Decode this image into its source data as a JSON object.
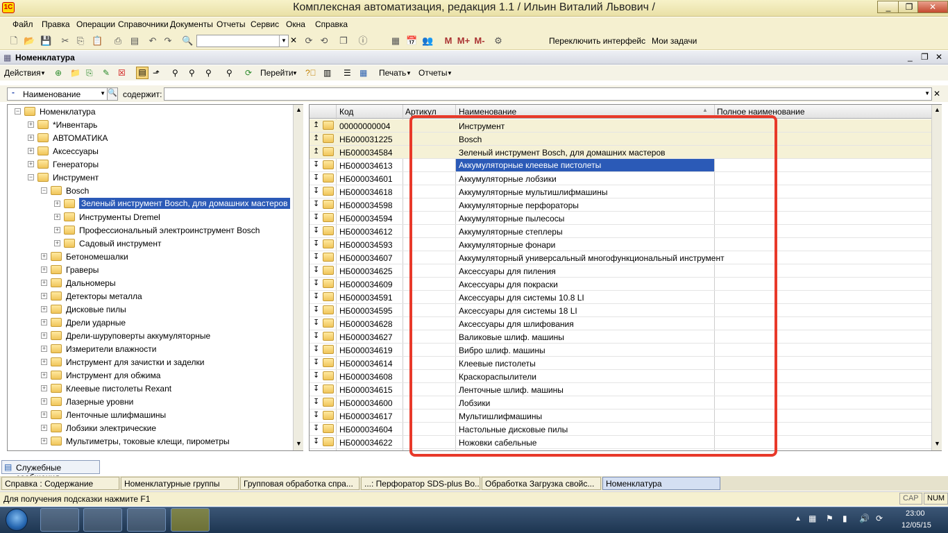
{
  "window": {
    "title": "Комплексная автоматизация, редакция 1.1 / Ильин Виталий Львович /",
    "logo_text": "1С"
  },
  "menu": [
    "Файл",
    "Правка",
    "Операции",
    "Справочники",
    "Документы",
    "Отчеты",
    "Сервис",
    "Окна",
    "Справка"
  ],
  "toolbar1": {
    "switch_interface": "Переключить интерфейс",
    "my_tasks": "Мои задачи",
    "m": "M",
    "m_plus": "M+",
    "m_minus": "M-"
  },
  "document": {
    "title": "Номенклатура"
  },
  "toolbar2": {
    "actions": "Действия",
    "goto": "Перейти",
    "print": "Печать",
    "reports": "Отчеты"
  },
  "filter": {
    "field": "Наименование",
    "contains_label": "содержит:",
    "value": ""
  },
  "tree": {
    "items": [
      {
        "label": "Номенклатура",
        "level": 0,
        "expanded": true
      },
      {
        "label": "*Инвентарь",
        "level": 1
      },
      {
        "label": "АВТОМАТИКА",
        "level": 1
      },
      {
        "label": "Аксессуары",
        "level": 1
      },
      {
        "label": "Генераторы",
        "level": 1
      },
      {
        "label": "Инструмент",
        "level": 1,
        "expanded": true
      },
      {
        "label": "Bosch",
        "level": 2,
        "expanded": true
      },
      {
        "label": "Зеленый инструмент Bosch, для домашних мастеров",
        "level": 3,
        "selected": true
      },
      {
        "label": "Инструменты Dremel",
        "level": 3
      },
      {
        "label": "Профессиональный электроинструмент Bosch",
        "level": 3
      },
      {
        "label": "Садовый инструмент",
        "level": 3
      },
      {
        "label": "Бетономешалки",
        "level": 2
      },
      {
        "label": "Граверы",
        "level": 2
      },
      {
        "label": "Дальномеры",
        "level": 2
      },
      {
        "label": "Детекторы металла",
        "level": 2
      },
      {
        "label": "Дисковые пилы",
        "level": 2
      },
      {
        "label": "Дрели ударные",
        "level": 2
      },
      {
        "label": "Дрели-шуруповерты аккумуляторные",
        "level": 2
      },
      {
        "label": "Измерители влажности",
        "level": 2
      },
      {
        "label": "Инструмент для зачистки и заделки",
        "level": 2
      },
      {
        "label": "Инструмент для обжима",
        "level": 2
      },
      {
        "label": "Клеевые пистолеты Rexant",
        "level": 2
      },
      {
        "label": "Лазерные уровни",
        "level": 2
      },
      {
        "label": "Ленточные шлифмашины",
        "level": 2
      },
      {
        "label": "Лобзики электрические",
        "level": 2
      },
      {
        "label": "Мультиметры, токовые клещи, пирометры",
        "level": 2
      }
    ]
  },
  "grid": {
    "columns": {
      "code": "Код",
      "article": "Артикул",
      "name": "Наименование",
      "full_name": "Полное наименование"
    },
    "rows": [
      {
        "code": "00000000004",
        "name": "Инструмент",
        "group": true
      },
      {
        "code": "НБ000031225",
        "name": "Bosch",
        "group": true
      },
      {
        "code": "НБ000034584",
        "name": "Зеленый инструмент Bosch, для домашних мастеров",
        "group": true
      },
      {
        "code": "НБ000034613",
        "name": "Аккумуляторные клеевые пистолеты",
        "selected": true
      },
      {
        "code": "НБ000034601",
        "name": "Аккумуляторные лобзики"
      },
      {
        "code": "НБ000034618",
        "name": "Аккумуляторные мультишлифмашины"
      },
      {
        "code": "НБ000034598",
        "name": "Аккумуляторные перфораторы"
      },
      {
        "code": "НБ000034594",
        "name": "Аккумуляторные пылесосы"
      },
      {
        "code": "НБ000034612",
        "name": "Аккумуляторные степлеры"
      },
      {
        "code": "НБ000034593",
        "name": "Аккумуляторные фонари"
      },
      {
        "code": "НБ000034607",
        "name": "Аккумуляторный универсальный многофункциональный инструмент"
      },
      {
        "code": "НБ000034625",
        "name": "Аксессуары для пиления"
      },
      {
        "code": "НБ000034609",
        "name": "Аксессуары для покраски"
      },
      {
        "code": "НБ000034591",
        "name": "Аксессуары для системы 10.8 LI"
      },
      {
        "code": "НБ000034595",
        "name": "Аксессуары для системы 18 LI"
      },
      {
        "code": "НБ000034628",
        "name": "Аксессуары для шлифования"
      },
      {
        "code": "НБ000034627",
        "name": "Валиковые шлиф. машины"
      },
      {
        "code": "НБ000034619",
        "name": "Вибро шлиф. машины"
      },
      {
        "code": "НБ000034614",
        "name": "Клеевые пистолеты"
      },
      {
        "code": "НБ000034608",
        "name": "Краскораспылители"
      },
      {
        "code": "НБ000034615",
        "name": "Ленточные шлиф. машины"
      },
      {
        "code": "НБ000034600",
        "name": "Лобзики"
      },
      {
        "code": "НБ000034617",
        "name": "Мультишлифмашины"
      },
      {
        "code": "НБ000034604",
        "name": "Настольные дисковые пилы"
      },
      {
        "code": "НБ000034622",
        "name": "Ножовки сабельные"
      }
    ]
  },
  "service_messages": "Служебные сообщения",
  "open_windows": [
    "Справка : Содержание",
    "Номенклатурные группы",
    "Групповая обработка спра...",
    "...: Перфоратор SDS-plus Bo...",
    "Обработка  Загрузка свойс...",
    "Номенклатура"
  ],
  "status": {
    "hint": "Для получения подсказки нажмите F1",
    "cap": "CAP",
    "num": "NUM"
  },
  "clock": {
    "time": "23:00",
    "date": "12/05/15"
  },
  "colors": {
    "selection": "#2b5ab7",
    "highlight": "#e8392a",
    "group_row": "#f5f1d6"
  }
}
